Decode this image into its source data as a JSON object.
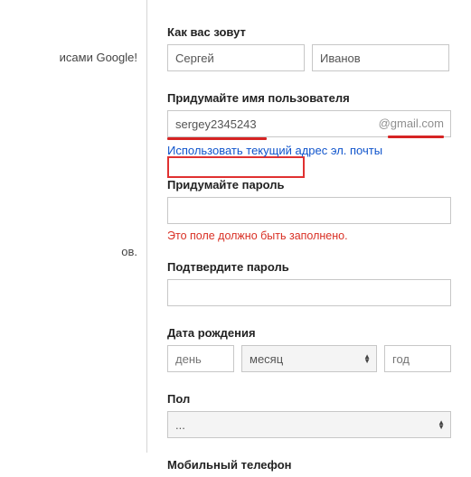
{
  "left": {
    "snippet1": "исами Google!",
    "snippet2": "ов."
  },
  "form": {
    "name_label": "Как вас зовут",
    "first_name_value": "Сергей",
    "last_name_value": "Иванов",
    "username_label": "Придумайте имя пользователя",
    "username_value": "sergey2345243",
    "domain_suffix": "@gmail.com",
    "use_current_link": "Использовать текущий адрес эл. почты",
    "password_label": "Придумайте пароль",
    "password_value": "",
    "password_error": "Это поле должно быть заполнено.",
    "confirm_label": "Подтвердите пароль",
    "confirm_value": "",
    "birth_label": "Дата рождения",
    "day_placeholder": "день",
    "month_placeholder": "месяц",
    "year_placeholder": "год",
    "gender_label": "Пол",
    "gender_value": "...",
    "phone_label": "Мобильный телефон"
  }
}
